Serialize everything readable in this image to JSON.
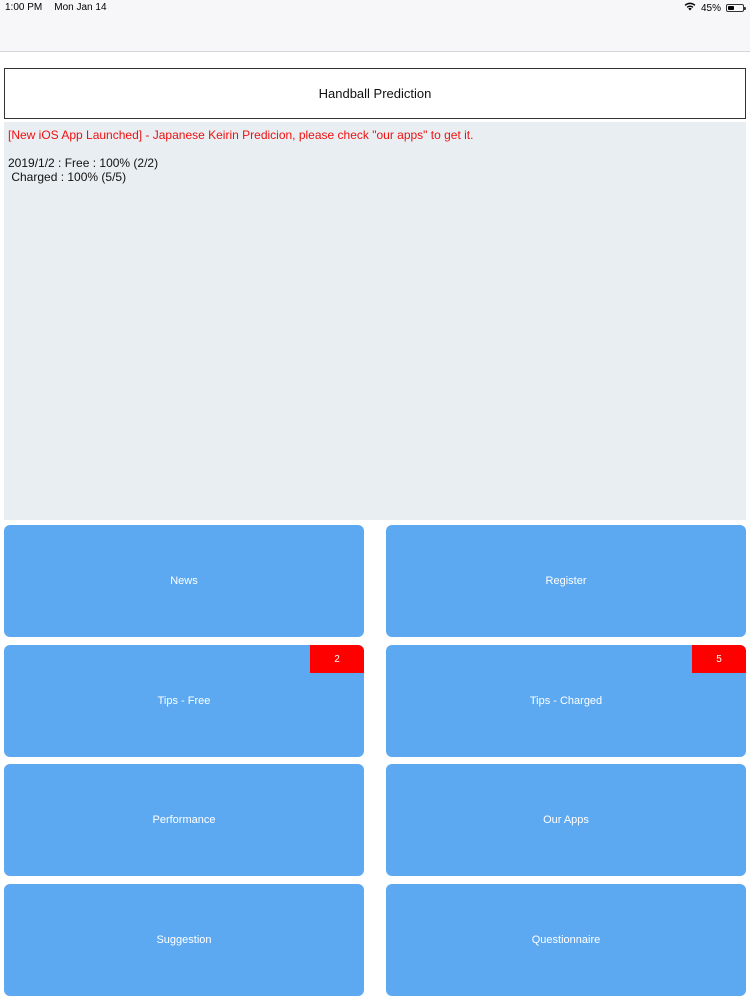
{
  "status_bar": {
    "time": "1:00 PM",
    "date": "Mon Jan 14",
    "wifi_icon": "wifi-icon",
    "battery_percent": "45%",
    "battery_level": 0.45
  },
  "header": {
    "title": "Handball Prediction"
  },
  "news": {
    "announcement": "[New iOS App Launched] - Japanese Keirin Predicion, please check \"our apps\" to get it.",
    "results": "2019/1/2 : Free : 100% (2/2)\n Charged : 100% (5/5)"
  },
  "buttons": {
    "news": "News",
    "register": "Register",
    "tips_free": "Tips - Free",
    "tips_free_badge": "2",
    "tips_charged": "Tips - Charged",
    "tips_charged_badge": "5",
    "performance": "Performance",
    "our_apps": "Our Apps",
    "suggestion": "Suggestion",
    "questionnaire": "Questionnaire"
  },
  "colors": {
    "button": "#5ca9f2",
    "badge": "#ff0000",
    "announcement": "#f01010",
    "news_bg": "#e9eef2"
  }
}
